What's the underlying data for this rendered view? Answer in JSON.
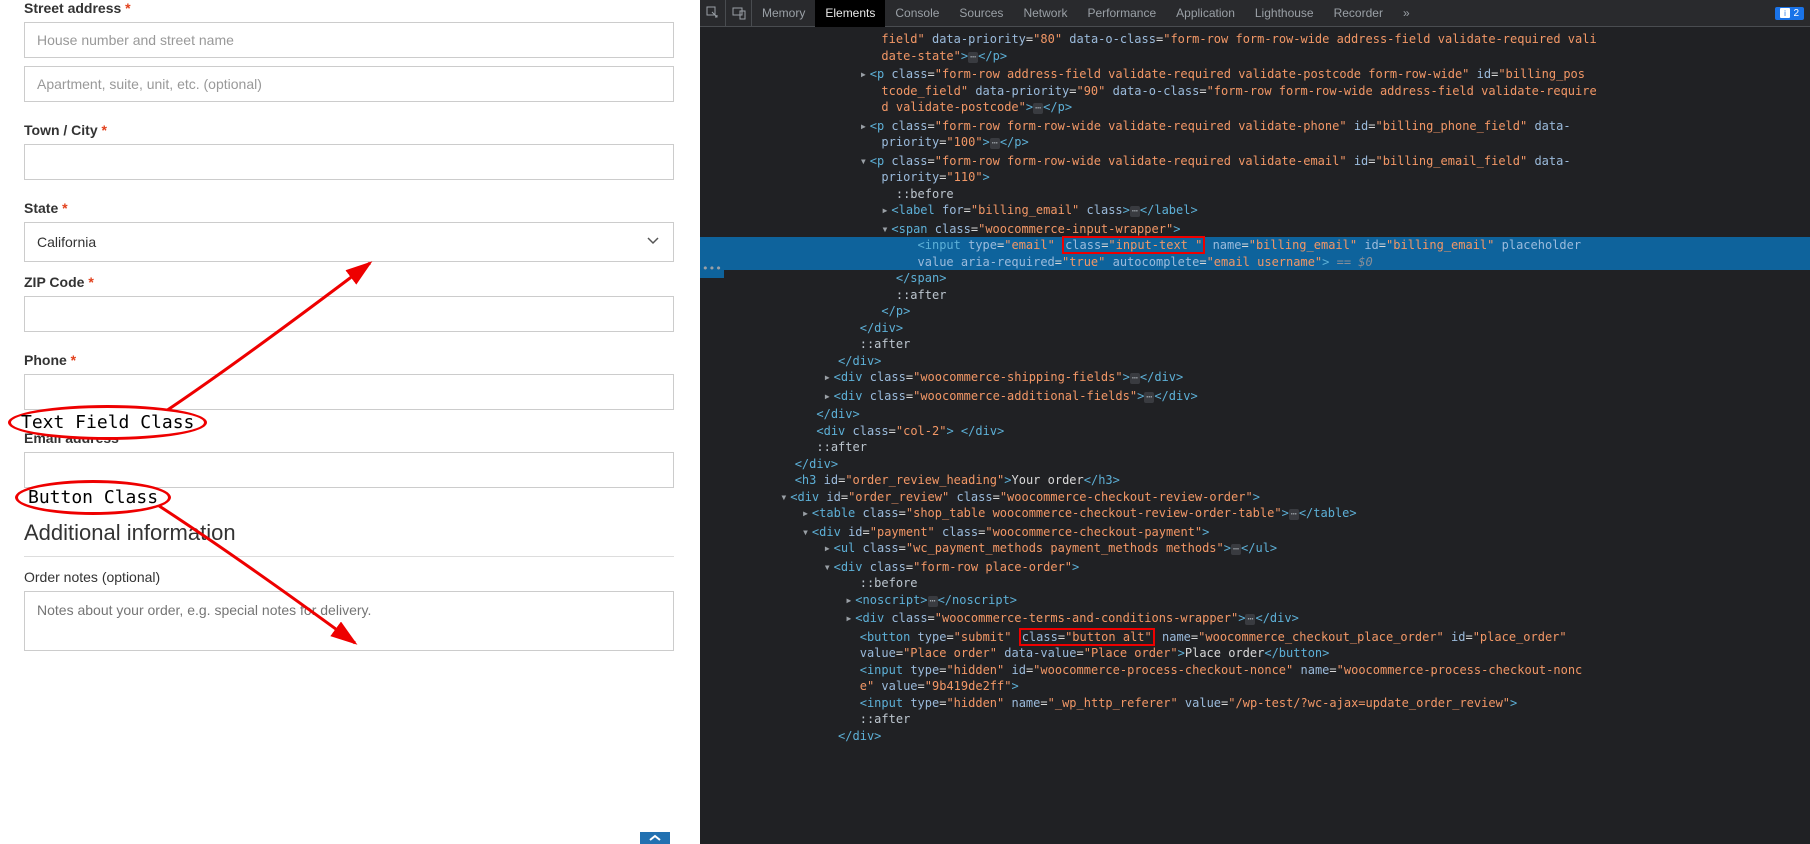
{
  "form": {
    "street_label": "Street address",
    "street_ph1": "House number and street name",
    "street_ph2": "Apartment, suite, unit, etc. (optional)",
    "town_label": "Town / City",
    "state_label": "State",
    "state_value": "California",
    "zip_label": "ZIP Code",
    "phone_label": "Phone",
    "email_label": "Email address",
    "additional_heading": "Additional information",
    "order_notes_label": "Order notes (optional)",
    "order_notes_ph": "Notes about your order, e.g. special notes for delivery."
  },
  "annotations": {
    "text_field": "Text Field Class",
    "button": "Button Class"
  },
  "devtools": {
    "tabs": [
      "Memory",
      "Elements",
      "Console",
      "Sources",
      "Network",
      "Performance",
      "Application",
      "Lighthouse",
      "Recorder"
    ],
    "active_tab": "Elements",
    "issue_count": "2"
  },
  "dom": {
    "l1_a": "field\"",
    "l1_b": "data-priority",
    "l1_c": "\"80\"",
    "l1_d": "data-o-class",
    "l1_e": "\"form-row form-row-wide address-field validate-required vali",
    "l1_f": "date-state\"",
    "l2_a": "\"form-row address-field validate-required validate-postcode form-row-wide\"",
    "l2_b": "\"billing_pos",
    "l2_c": "tcode_field\"",
    "l2_d": "\"90\"",
    "l2_e": "\"form-row form-row-wide address-field validate-require",
    "l2_f": "d validate-postcode\"",
    "l3_a": "\"form-row form-row-wide validate-required validate-phone\"",
    "l3_b": "\"billing_phone_field\"",
    "l3_c": "data-",
    "l3_d": "priority",
    "l3_e": "\"100\"",
    "l4_a": "\"form-row form-row-wide validate-required validate-email\"",
    "l4_b": "\"billing_email_field\"",
    "l4_c": "\"110\"",
    "before": "::before",
    "l5_a": "\"billing_email\"",
    "l6_a": "\"woocommerce-input-wrapper\"",
    "l7_a": "\"email\"",
    "l7_b": "\"input-text \"",
    "l7_c": "\"billing_email\"",
    "l7_d": "\"billing_email\"",
    "l8_a": "\"true\"",
    "l8_b": "\"email username\"",
    "l8_c": " == $0",
    "after": "::after",
    "l9_a": "\"woocommerce-shipping-fields\"",
    "l10_a": "\"woocommerce-additional-fields\"",
    "l11_a": "\"col-2\"",
    "l12_a": "\"order_review_heading\"",
    "l12_txt": "Your order",
    "l13_a": "\"order_review\"",
    "l13_b": "\"woocommerce-checkout-review-order\"",
    "l14_a": "\"shop_table woocommerce-checkout-review-order-table\"",
    "l15_a": "\"payment\"",
    "l15_b": "\"woocommerce-checkout-payment\"",
    "l16_a": "\"wc_payment_methods payment_methods methods\"",
    "l17_a": "\"form-row place-order\"",
    "l18_a": "\"woocommerce-terms-and-conditions-wrapper\"",
    "l19_a": "\"submit\"",
    "l19_b": "\"button alt\"",
    "l19_c": "\"woocommerce_checkout_place_order\"",
    "l19_d": "\"place_order\"",
    "l20_a": "\"Place order\"",
    "l20_b": "\"Place order\"",
    "l20_txt": "Place order",
    "l21_a": "\"hidden\"",
    "l21_b": "\"woocommerce-process-checkout-nonce\"",
    "l21_c": "\"woocommerce-process-checkout-nonc",
    "l21_d": "e\"",
    "l21_e": "\"9b419de2ff\"",
    "l22_a": "\"hidden\"",
    "l22_b": "\"_wp_http_referer\"",
    "l22_c": "\"/wp-test/?wc-ajax=update_order_review\""
  }
}
